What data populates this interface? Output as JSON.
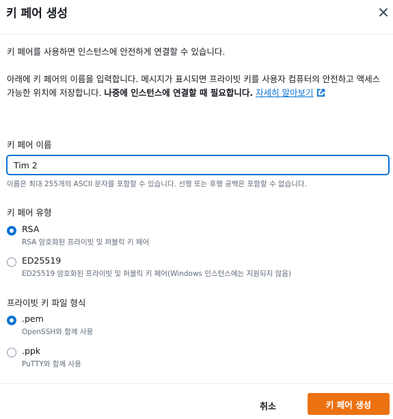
{
  "dialog": {
    "title": "키 페어 생성",
    "close_icon": "close-icon"
  },
  "intro": {
    "line1": "키 페어를 사용하면 인스턴스에 안전하게 연결할 수 있습니다.",
    "para_part1": "아래에 키 페어의 이름을 입력합니다. 메시지가 표시되면 프라이빗 키를 사용자 컴퓨터의 안전하고 액세스 가능한 위치에 저장합니다. ",
    "para_bold": "나중에 인스턴스에 연결할 때 필요합니다.",
    "para_link": "자세히 알아보기",
    "link_icon": "external-link-icon"
  },
  "name_field": {
    "label": "키 페어 이름",
    "value": "Tim 2",
    "hint": "이름은 최대 255개의 ASCII 문자를 포함할 수 있습니다. 선행 또는 후행 공백은 포함할 수 없습니다."
  },
  "key_type": {
    "label": "키 페어 유형",
    "options": [
      {
        "label": "RSA",
        "desc": "RSA 암호화된 프라이빗 및 퍼블릭 키 페어",
        "selected": true
      },
      {
        "label": "ED25519",
        "desc": "ED25519 암호화된 프라이빗 및 퍼블릭 키 페어(Windows 인스턴스에는 지원되지 않음)",
        "selected": false
      }
    ]
  },
  "file_format": {
    "label": "프라이빗 키 파일 형식",
    "options": [
      {
        "label": ".pem",
        "desc": "OpenSSH와 함께 사용",
        "selected": true
      },
      {
        "label": ".ppk",
        "desc": "PuTTY와 함께 사용",
        "selected": false
      }
    ]
  },
  "footer": {
    "cancel_label": "취소",
    "create_label": "키 페어 생성"
  },
  "colors": {
    "primary": "#ec7211",
    "link": "#0972d3",
    "text": "#16191f",
    "muted": "#5f6b7a"
  }
}
